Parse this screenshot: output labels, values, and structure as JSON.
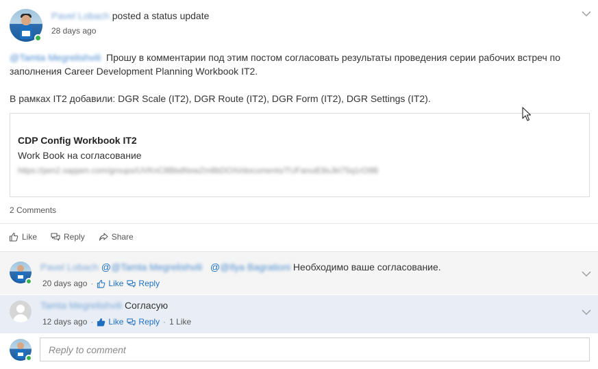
{
  "post": {
    "author": "Pavel Lobach",
    "action": "posted a status update",
    "time": "28 days ago",
    "mention": "@Tamta Megrelishvili",
    "text_line1": "Прошу в комментарии под этим постом согласовать результаты проведения серии рабочих встреч по",
    "text_line2": "заполнения Career Development Planning Workbook IT2.",
    "text_para2": "В рамках IT2 добавили:  DGR Scale (IT2), DGR Route (IT2), DGR Form (IT2), DGR Settings (IT2).",
    "link": {
      "title": "CDP Config Workbook IT2",
      "description": "Work Book на согласование",
      "url": "https://jam2.sapjam.com/groups/UVKnC8BbdNxwZm8bDOXi/documents/TUFanuiE8sJkI75q1rO9B"
    },
    "comments_count": "2 Comments"
  },
  "actions": {
    "like": "Like",
    "reply": "Reply",
    "share": "Share"
  },
  "comments": [
    {
      "author": "Pavel Lobach",
      "mention1": "@Tamta Megrelishvili",
      "mention2": "@Ilya Bagrationi",
      "text": "Необходимо ваше согласование.",
      "time": "20 days ago",
      "like": "Like",
      "reply": "Reply"
    },
    {
      "author": "Tamta Megrelishvili",
      "text": "Согласую",
      "time": "12 days ago",
      "like": "Like",
      "reply": "Reply",
      "likes_count": "1 Like"
    }
  ],
  "reply_box": {
    "placeholder": "Reply to comment"
  },
  "colors": {
    "link": "#1f6fbf",
    "presence": "#37b24d",
    "comment_bg": "#f5f5f5",
    "comment_highlight_bg": "#e9eef6"
  },
  "icons": {
    "like": "thumbs-up-icon",
    "reply": "reply-bubble-icon",
    "share": "share-arrow-icon",
    "menu": "chevron-down-icon"
  }
}
